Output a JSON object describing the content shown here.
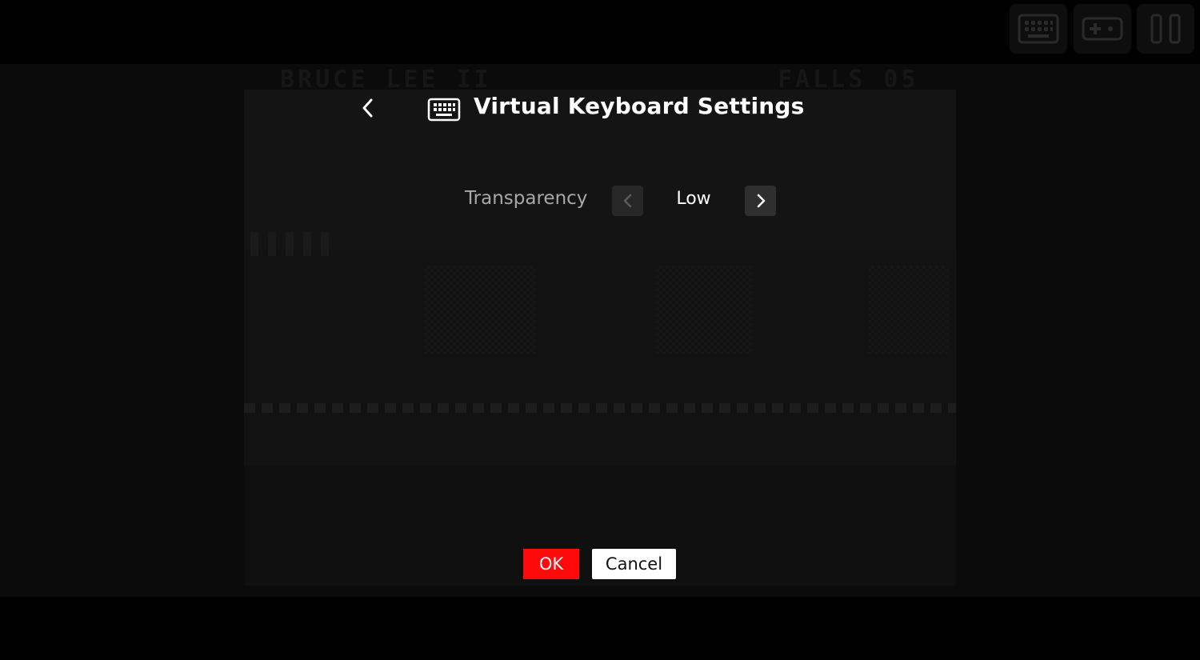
{
  "background_game": {
    "hud_left": "BRUCE LEE II",
    "hud_right": "FALLS 05"
  },
  "toolbar": {
    "buttons": [
      {
        "icon": "keyboard-icon"
      },
      {
        "icon": "gamepad-icon"
      },
      {
        "icon": "pause-icon"
      }
    ]
  },
  "dialog": {
    "title": "Virtual Keyboard Settings",
    "title_icon": "keyboard-icon",
    "back_icon": "chevron-left-icon",
    "settings": [
      {
        "label": "Transparency",
        "value": "Low",
        "prev_icon": "chevron-left-icon",
        "next_icon": "chevron-right-icon"
      }
    ],
    "ok_label": "OK",
    "cancel_label": "Cancel"
  },
  "colors": {
    "accent": "#ff0a0a",
    "background": "#000000",
    "dim_overlay": "#0b0b0b",
    "text_primary": "#ffffff",
    "text_secondary": "#a8a8a8"
  }
}
